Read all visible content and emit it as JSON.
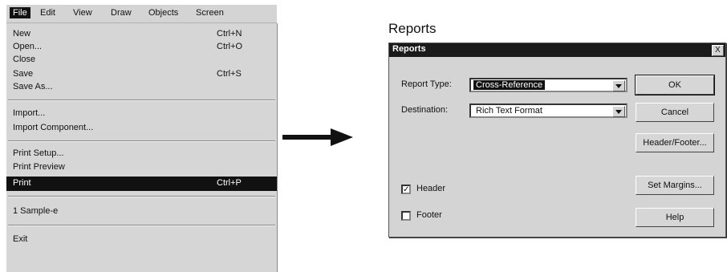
{
  "menu": {
    "bar": [
      "File",
      "Edit",
      "View",
      "Draw",
      "Objects",
      "Screen"
    ],
    "items": [
      {
        "label": "New",
        "shortcut": "Ctrl+N"
      },
      {
        "label": "Open...",
        "shortcut": "Ctrl+O"
      },
      {
        "label": "Close",
        "shortcut": ""
      },
      {
        "label": "Save",
        "shortcut": "Ctrl+S"
      },
      {
        "label": "Save As...",
        "shortcut": ""
      },
      {
        "label": "Import...",
        "shortcut": ""
      },
      {
        "label": "Import Component...",
        "shortcut": ""
      },
      {
        "label": "Print Setup...",
        "shortcut": ""
      },
      {
        "label": "Print Preview",
        "shortcut": ""
      },
      {
        "label": "Print",
        "shortcut": "Ctrl+P"
      },
      {
        "label": "1 Sample-e",
        "shortcut": ""
      },
      {
        "label": "Exit",
        "shortcut": ""
      }
    ]
  },
  "caption": "Reports",
  "dialog": {
    "title": "Reports",
    "close_glyph": "X",
    "report_type_label": "Report Type:",
    "report_type_value": "Cross-Reference",
    "destination_label": "Destination:",
    "destination_value": "Rich Text Format",
    "header_label": "Header",
    "header_checked": true,
    "footer_label": "Footer",
    "footer_checked": false,
    "buttons": {
      "ok": "OK",
      "cancel": "Cancel",
      "header_footer": "Header/Footer...",
      "set_margins": "Set Margins...",
      "help": "Help"
    }
  },
  "icons": {
    "arrow": "right-arrow-icon"
  },
  "colors": {
    "highlight": "#111111",
    "dialog_face": "#d4d4d4"
  }
}
